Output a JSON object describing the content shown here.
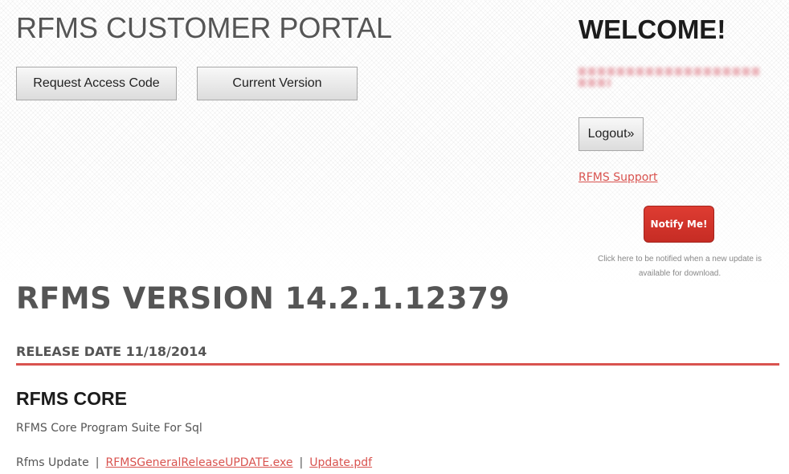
{
  "header": {
    "portal_title": "RFMS CUSTOMER PORTAL",
    "buttons": {
      "request_access_code": "Request Access Code",
      "current_version": "Current Version"
    }
  },
  "account": {
    "welcome": "WELCOME!",
    "logout_label": "Logout»",
    "support_link": "RFMS Support",
    "notify_button": "Notify Me!",
    "notify_caption": "Click here to be notified when a new update is available for download."
  },
  "release": {
    "version_title": "RFMS VERSION 14.2.1.12379",
    "release_date": "RELEASE DATE 11/18/2014",
    "sections": [
      {
        "title": "RFMS CORE",
        "description": "RFMS Core Program Suite For Sql",
        "update_label": "Rfms Update",
        "separator": "|",
        "links": [
          "RFMSGeneralReleaseUPDATE.exe",
          "Update.pdf"
        ]
      }
    ]
  },
  "colors": {
    "accent": "#d9534f",
    "notify_button": "#d0342c",
    "title_text": "#555555"
  }
}
